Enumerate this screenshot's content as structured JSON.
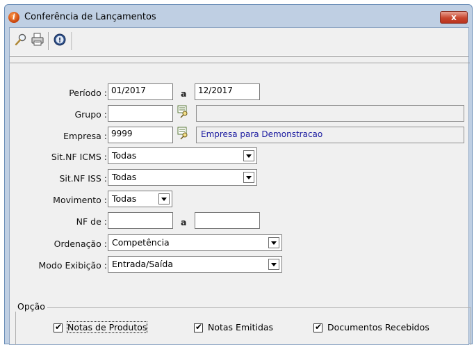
{
  "window": {
    "title": "Conferência de Lançamentos",
    "close_label": "x"
  },
  "toolbar": {
    "items": [
      "search-icon",
      "printer-icon",
      "info-icon"
    ]
  },
  "form": {
    "periodo": {
      "label": "Período :",
      "from": "01/2017",
      "to": "12/2017",
      "sep": "a"
    },
    "grupo": {
      "label": "Grupo :",
      "value": "",
      "description": ""
    },
    "empresa": {
      "label": "Empresa :",
      "value": "9999",
      "description": "Empresa para Demonstracao"
    },
    "sit_icms": {
      "label": "Sit.NF ICMS :",
      "value": "Todas"
    },
    "sit_iss": {
      "label": "Sit.NF ISS :",
      "value": "Todas"
    },
    "movimento": {
      "label": "Movimento :",
      "value": "Todas"
    },
    "nf": {
      "label": "NF de :",
      "from": "",
      "to": "",
      "sep": "a"
    },
    "ordenacao": {
      "label": "Ordenação :",
      "value": "Competência"
    },
    "modo": {
      "label": "Modo Exibição :",
      "value": "Entrada/Saída"
    }
  },
  "opcao": {
    "label": "Opção",
    "items": [
      {
        "label": "Notas de Produtos",
        "checked": true
      },
      {
        "label": "Notas Emitidas",
        "checked": true
      },
      {
        "label": "Documentos Recebidos",
        "checked": true
      }
    ]
  },
  "colors": {
    "titlebar": "#bfcfe3",
    "client": "#f0f0f0",
    "close": "#c9462f",
    "description_text": "#1a1aa0"
  }
}
